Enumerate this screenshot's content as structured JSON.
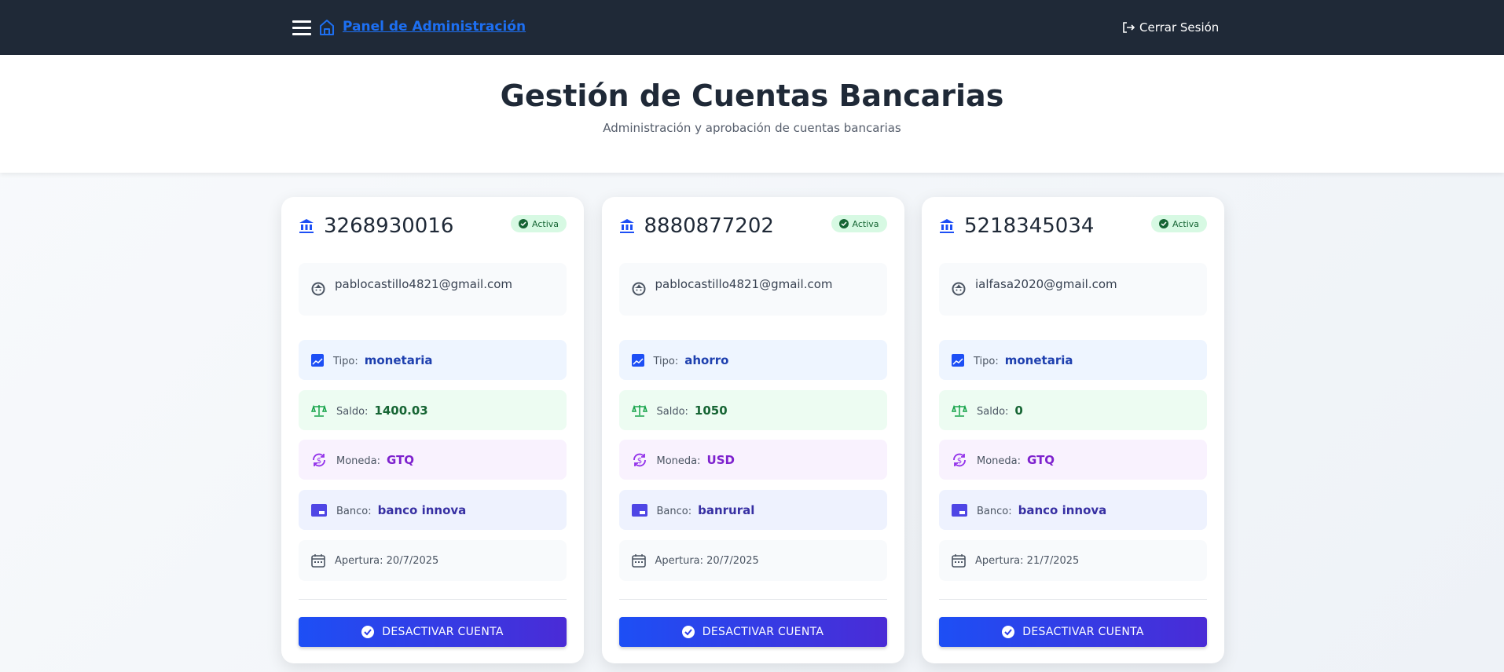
{
  "nav": {
    "brand": "Panel de Administración",
    "logout": "Cerrar Sesión"
  },
  "hero": {
    "title": "Gestión de Cuentas Bancarias",
    "subtitle": "Administración y aprobación de cuentas bancarias"
  },
  "labels": {
    "tipo": "Tipo:",
    "saldo": "Saldo:",
    "moneda": "Moneda:",
    "banco": "Banco:"
  },
  "colors": {
    "accent": "#1d4ff5",
    "nav": "#1f2937"
  },
  "cards": [
    {
      "number": "3268930016",
      "status": "Activa",
      "email": "pablocastillo4821@gmail.com",
      "tipo": "monetaria",
      "saldo": "1400.03",
      "moneda": "GTQ",
      "banco": "banco innova",
      "apertura": "Apertura: 20/7/2025",
      "button": "DESACTIVAR CUENTA"
    },
    {
      "number": "8880877202",
      "status": "Activa",
      "email": "pablocastillo4821@gmail.com",
      "tipo": "ahorro",
      "saldo": "1050",
      "moneda": "USD",
      "banco": "banrural",
      "apertura": "Apertura: 20/7/2025",
      "button": "DESACTIVAR CUENTA"
    },
    {
      "number": "5218345034",
      "status": "Activa",
      "email": "ialfasa2020@gmail.com",
      "tipo": "monetaria",
      "saldo": "0",
      "moneda": "GTQ",
      "banco": "banco innova",
      "apertura": "Apertura: 21/7/2025",
      "button": "DESACTIVAR CUENTA"
    }
  ]
}
